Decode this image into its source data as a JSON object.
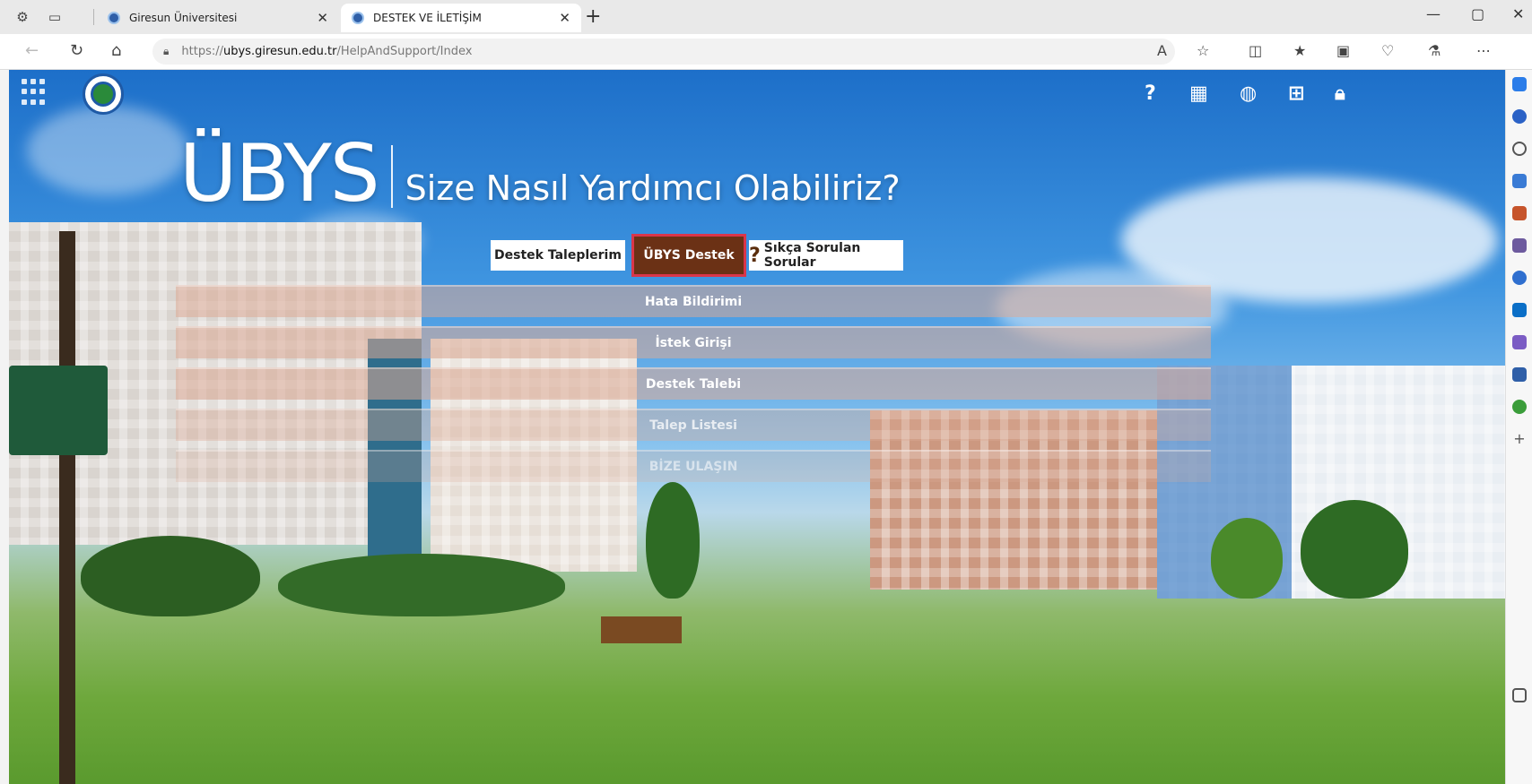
{
  "browser": {
    "tabs": [
      {
        "title": "Giresun Üniversitesi",
        "active": false
      },
      {
        "title": "DESTEK VE İLETİŞİM",
        "active": true
      }
    ],
    "url_prefix": "https://",
    "url_domain": "ubys.giresun.edu.tr",
    "url_path": "/HelpAndSupport/Index"
  },
  "hero": {
    "brand": "ÜBYS",
    "tagline": "Size Nasıl Yardımcı Olabiliriz?"
  },
  "buttons": {
    "taleplerim": "Destek Taleplerim",
    "ubys_destek": "ÜBYS Destek",
    "sss": "Sıkça Sorulan Sorular"
  },
  "menu": [
    {
      "label": "Hata Bildirimi"
    },
    {
      "label": "İstek Girişi"
    },
    {
      "label": "Destek Talebi"
    },
    {
      "label": "Talep Listesi"
    },
    {
      "label": "BİZE ULAŞIN"
    }
  ],
  "colors": {
    "accent_brown": "#6b3115",
    "highlight_red": "#d9364a",
    "logo_blue": "#1f5aa6"
  }
}
